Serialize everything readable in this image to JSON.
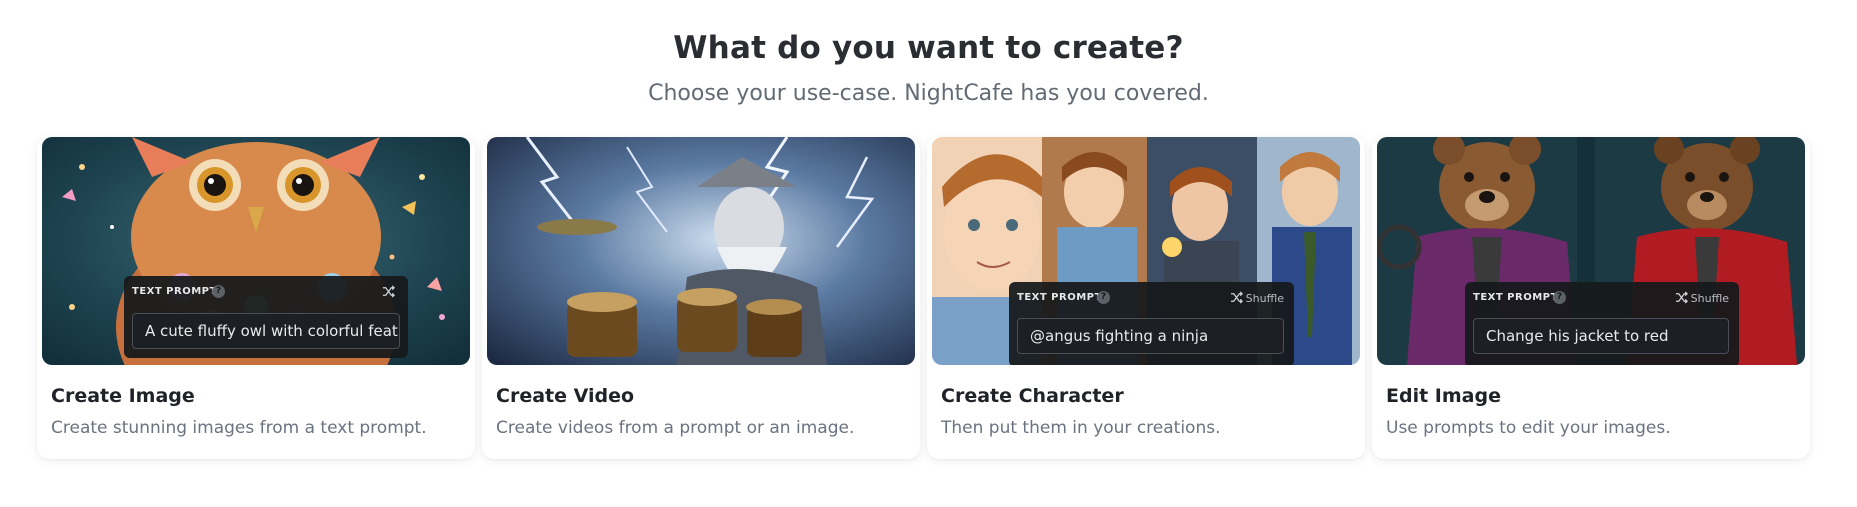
{
  "header": {
    "title": "What do you want to create?",
    "subtitle": "Choose your use-case. NightCafe has you covered."
  },
  "cards": [
    {
      "title": "Create Image",
      "description": "Create stunning images from a text prompt.",
      "image_icon": "owl-illustration",
      "prompt": {
        "label": "TEXT PROMPT",
        "value": "A cute fluffy owl with colorful feat...",
        "shuffle_label": ""
      }
    },
    {
      "title": "Create Video",
      "description": "Create videos from a prompt or an image.",
      "image_icon": "wizard-drummer-illustration"
    },
    {
      "title": "Create Character",
      "description": "Then put them in your creations.",
      "image_icon": "anime-character-collage",
      "prompt": {
        "label": "TEXT PROMPT",
        "value": "@angus fighting a ninja",
        "shuffle_label": "Shuffle"
      }
    },
    {
      "title": "Edit Image",
      "description": "Use prompts to edit your images.",
      "image_icon": "teddy-bears-illustration",
      "prompt": {
        "label": "TEXT PROMPT",
        "value": "Change his jacket to red",
        "shuffle_label": "Shuffle"
      }
    }
  ],
  "help_glyph": "?",
  "colors": {
    "title": "#2a2d31",
    "subtitle": "#626a73",
    "card_bg": "#ffffff",
    "prompt_bg": "#16191c"
  }
}
